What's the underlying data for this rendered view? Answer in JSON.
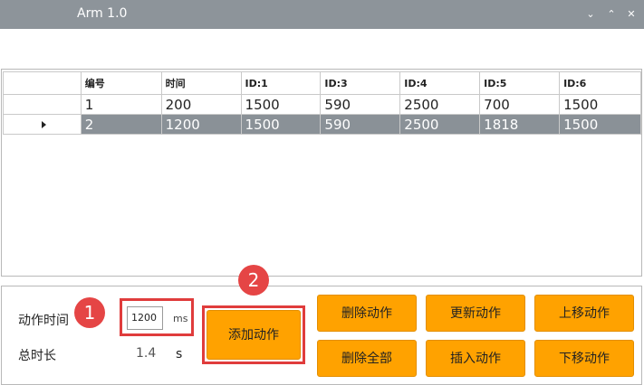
{
  "window": {
    "title": "Arm 1.0",
    "controls": [
      "⌄",
      "⌃",
      "✕"
    ]
  },
  "table": {
    "columns": [
      "编号",
      "时间",
      "ID:1",
      "ID:3",
      "ID:4",
      "ID:5",
      "ID:6"
    ],
    "rows": [
      [
        "1",
        "200",
        "1500",
        "590",
        "2500",
        "700",
        "1500"
      ],
      [
        "2",
        "1200",
        "1500",
        "590",
        "2500",
        "1818",
        "1500"
      ]
    ],
    "selected_row": 2
  },
  "controls": {
    "action_time_label": "动作时间",
    "action_time_value": "1200",
    "action_time_unit": "ms",
    "total_time_label": "总时长",
    "total_time_value": "1.4",
    "total_time_unit": "s",
    "add_action": "添加动作",
    "delete_action": "删除动作",
    "update_action": "更新动作",
    "move_up": "上移动作",
    "delete_all": "删除全部",
    "insert_action": "插入动作",
    "move_down": "下移动作"
  },
  "annotations": {
    "badge1": "1",
    "badge2": "2"
  },
  "colors": {
    "accent": "#ffa200",
    "highlight": "#e03c3c",
    "selected_row": "#8a9197",
    "titlebar": "#8d949a"
  }
}
